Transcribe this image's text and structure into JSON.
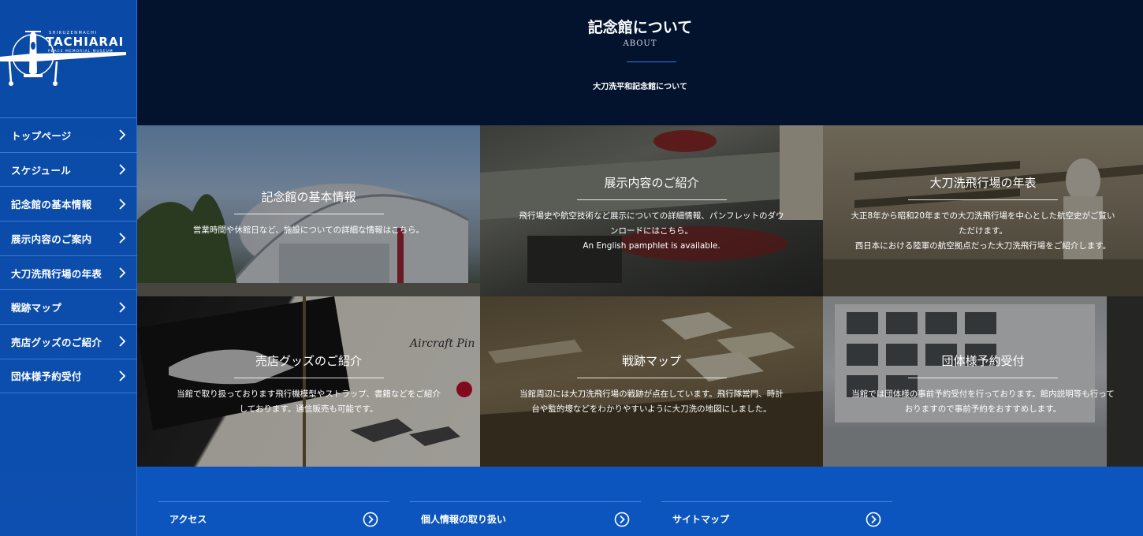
{
  "logo": {
    "small": "SHIKUZENMACHI",
    "big": "TACHIARAI",
    "sub": "PEACE MEMORIAL MUSEUM"
  },
  "sidebar": {
    "items": [
      {
        "label": "トップページ"
      },
      {
        "label": "スケジュール"
      },
      {
        "label": "記念館の基本情報"
      },
      {
        "label": "展示内容のご案内"
      },
      {
        "label": "大刀洗飛行場の年表"
      },
      {
        "label": "戦跡マップ"
      },
      {
        "label": "売店グッズのご紹介"
      },
      {
        "label": "団体様予約受付"
      }
    ]
  },
  "header": {
    "title": "記念館について",
    "subtitle": "ABOUT",
    "description": "大刀洗平和記念館について"
  },
  "tiles": [
    {
      "title": "記念館の基本情報",
      "lines": [
        "営業時間や休館日など、施設についての詳細な情報はこちら。"
      ]
    },
    {
      "title": "展示内容のご紹介",
      "lines": [
        "飛行場史や航空技術など展示についての詳細情報、パンフレットのダウ",
        "ンロードにはこちら。",
        "An English pamphlet is available."
      ]
    },
    {
      "title": "大刀洗飛行場の年表",
      "lines": [
        "大正8年から昭和20年までの大刀洗飛行場を中心とした航空史がご覧い",
        "ただけます。",
        "西日本における陸軍の航空拠点だった大刀洗飛行場をご紹介します。"
      ]
    },
    {
      "title": "売店グッズのご紹介",
      "lines": [
        "当館で取り扱っております飛行機模型やストラップ、書籍などをご紹介",
        "しております。通信販売も可能です。"
      ]
    },
    {
      "title": "戦跡マップ",
      "lines": [
        "当館周辺には大刀洗飛行場の戦跡が点在しています。飛行隊営門、時計",
        "台や監的壕などをわかりやすいように大刀洗の地図にしました。"
      ]
    },
    {
      "title": "団体様予約受付",
      "lines": [
        "当館では団体様の事前予約受付を行っております。館内説明等も行って",
        "おりますので事前予約をおすすめします。"
      ]
    }
  ],
  "tile_image_labels": {
    "aircraft_pin": "Aircraft Pin"
  },
  "footer": {
    "links": [
      {
        "label": "アクセス"
      },
      {
        "label": "個人情報の取り扱い"
      },
      {
        "label": "サイトマップ"
      }
    ]
  },
  "colors": {
    "sidebar": "#0a4aa6",
    "header": "#03132e",
    "footer": "#0c55bf",
    "accent_line": "#2f7adf"
  }
}
